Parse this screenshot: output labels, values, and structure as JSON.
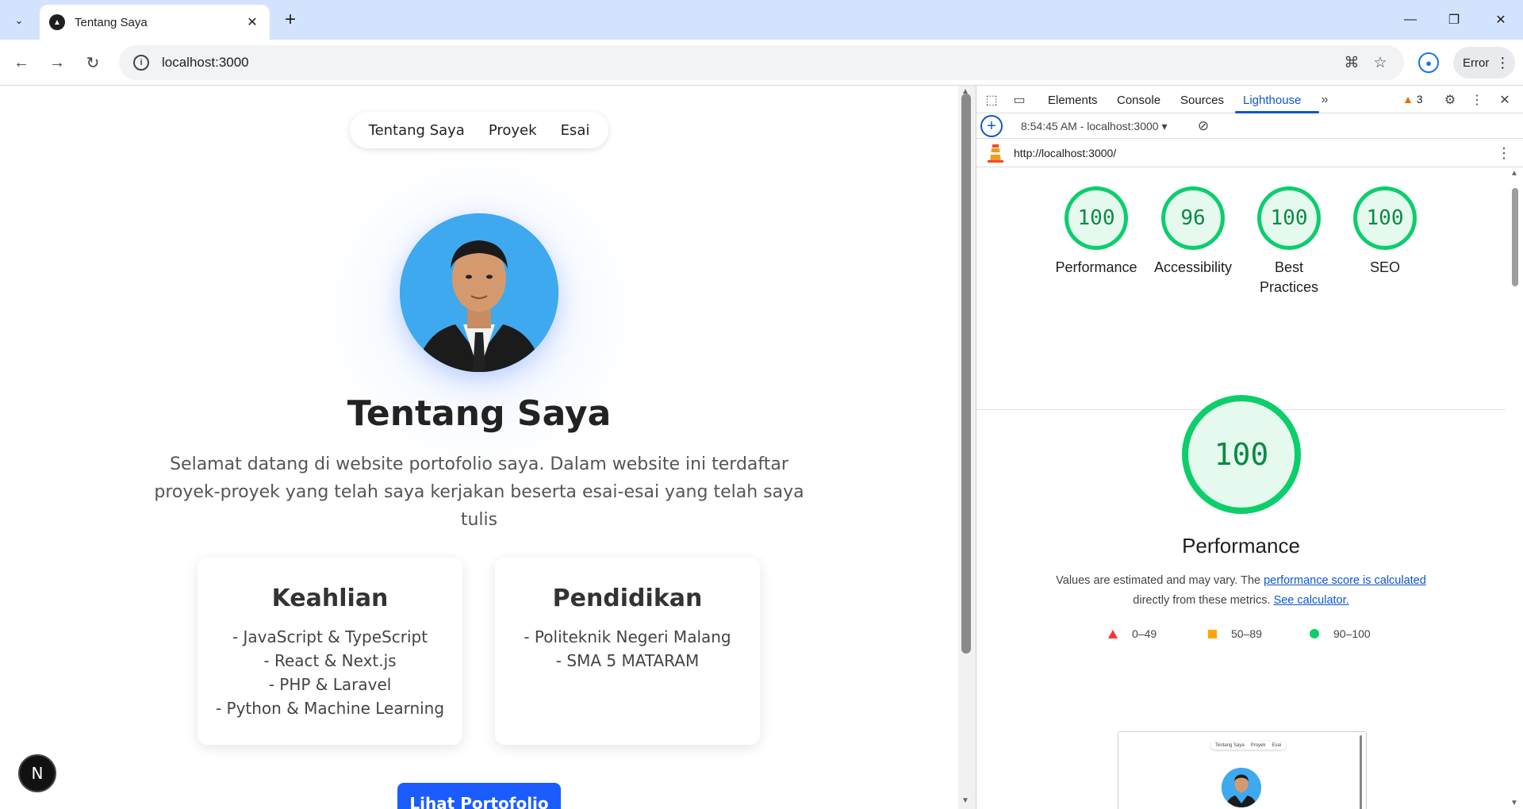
{
  "browser": {
    "tab_title": "Tentang Saya",
    "url": "localhost:3000",
    "error_label": "Error"
  },
  "site": {
    "nav": [
      "Tentang Saya",
      "Proyek",
      "Esai"
    ],
    "title": "Tentang Saya",
    "intro": "Selamat datang di website portofolio saya. Dalam website ini terdaftar proyek-proyek yang telah saya kerjakan beserta esai-esai yang telah saya tulis",
    "skills": {
      "title": "Keahlian",
      "items": [
        "- JavaScript & TypeScript",
        "- React & Next.js",
        "- PHP & Laravel",
        "- Python & Machine Learning"
      ]
    },
    "education": {
      "title": "Pendidikan",
      "items": [
        "- Politeknik Negeri Malang",
        "- SMA 5 MATARAM"
      ]
    },
    "cta_label": "Lihat Portofolio",
    "next_badge": "N"
  },
  "devtools": {
    "tabs": [
      "Elements",
      "Console",
      "Sources",
      "Lighthouse"
    ],
    "active_tab": "Lighthouse",
    "warning_count": "3",
    "report_label": "8:54:45 AM - localhost:3000",
    "report_url": "http://localhost:3000/",
    "scores": [
      {
        "label": "Performance",
        "value": "100"
      },
      {
        "label": "Accessibility",
        "value": "96"
      },
      {
        "label": "Best Practices",
        "value": "100"
      },
      {
        "label": "SEO",
        "value": "100"
      }
    ],
    "main_score": "100",
    "main_title": "Performance",
    "note_prefix": "Values are estimated and may vary. The ",
    "note_link1": "performance score is calculated",
    "note_middle": " directly from these metrics. ",
    "note_link2": "See calculator.",
    "legend": [
      "0–49",
      "50–89",
      "90–100"
    ],
    "thumb_nav": [
      "Tentang Saya",
      "Proyek",
      "Esai"
    ],
    "colors": {
      "pass": "#0cce6b",
      "average": "#ffa400",
      "fail": "#ff3333",
      "accent": "#0b57d0"
    }
  }
}
